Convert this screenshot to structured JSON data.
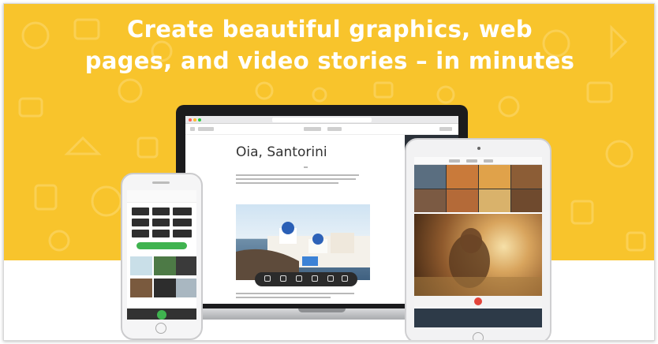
{
  "banner": {
    "headline_line1": "Create beautiful graphics, web",
    "headline_line2": "pages, and video stories – in minutes",
    "background_color": "#f8c42c",
    "text_color": "#ffffff"
  },
  "laptop": {
    "page": {
      "title": "Oia, Santorini"
    },
    "toolbar_icons": [
      "photo-icon",
      "text-icon",
      "button-icon",
      "split-icon",
      "glideshow-icon",
      "video-icon"
    ]
  },
  "ipad": {
    "record_button_color": "#e2443a"
  },
  "iphone": {
    "cta_color": "#3fb34f"
  }
}
